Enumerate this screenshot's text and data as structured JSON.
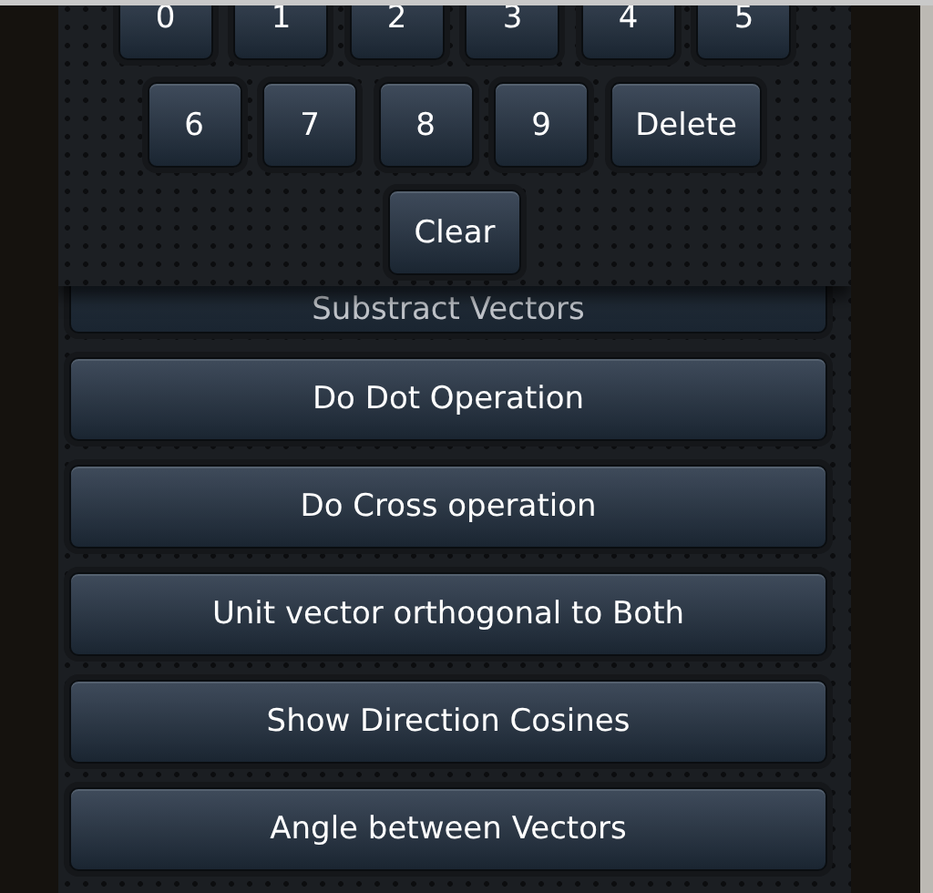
{
  "keypad": {
    "rows": [
      {
        "keys": [
          "0",
          "1",
          "2",
          "3",
          "4",
          "5"
        ]
      },
      {
        "keys": [
          "6",
          "7",
          "8",
          "9",
          "Delete"
        ]
      },
      {
        "keys": [
          "Clear"
        ]
      }
    ]
  },
  "actions": [
    "Substract Vectors",
    "Do Dot Operation",
    "Do Cross operation",
    "Unit vector orthogonal to Both",
    "Show Direction Cosines",
    "Angle between Vectors"
  ]
}
